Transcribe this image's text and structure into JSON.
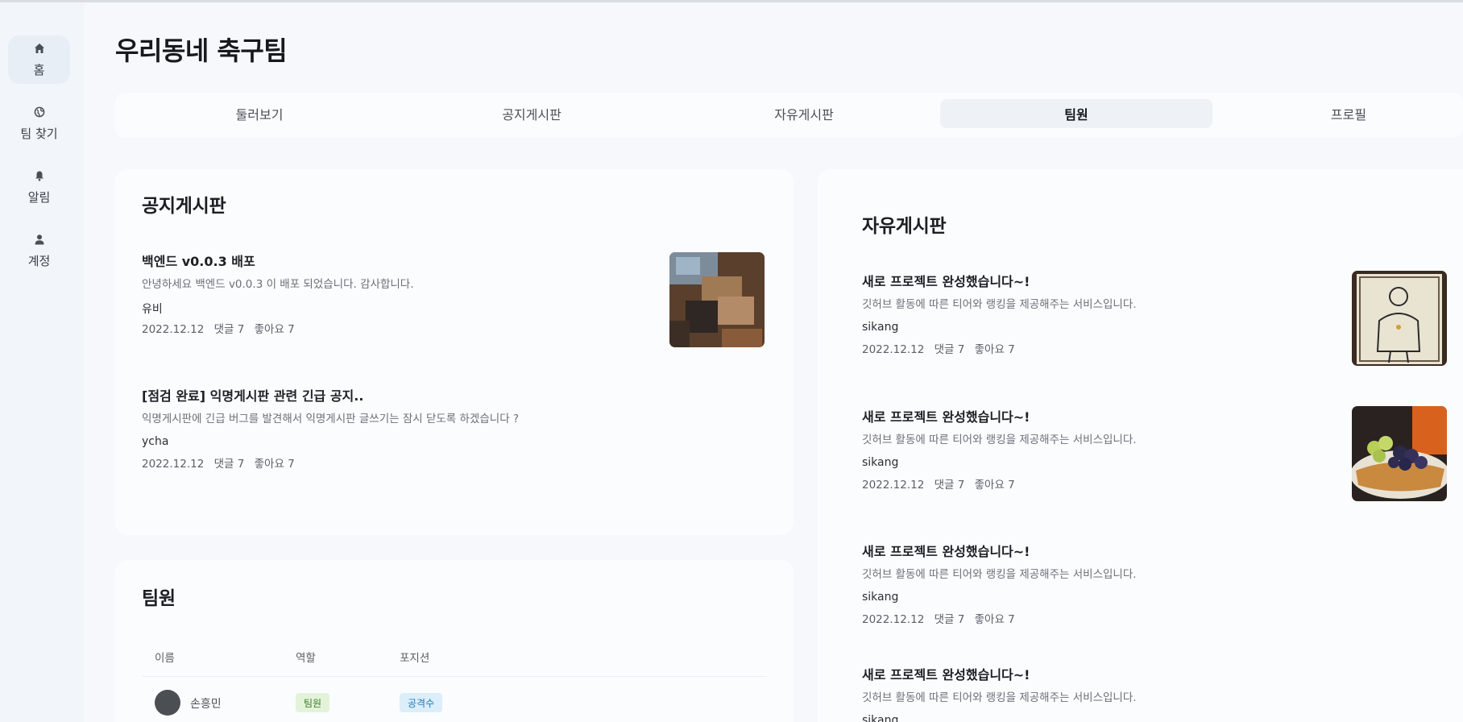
{
  "page_title": "우리동네 축구팀",
  "sidebar": {
    "items": [
      {
        "label": "홈",
        "icon": "home-icon",
        "active": true
      },
      {
        "label": "팀 찾기",
        "icon": "globe-icon",
        "active": false
      },
      {
        "label": "알림",
        "icon": "bell-icon",
        "active": false
      },
      {
        "label": "계정",
        "icon": "user-icon",
        "active": false
      }
    ]
  },
  "tabs": [
    {
      "label": "둘러보기"
    },
    {
      "label": "공지게시판"
    },
    {
      "label": "자유게시판"
    },
    {
      "label": "팀원",
      "active": true
    },
    {
      "label": "프로필"
    }
  ],
  "notice_board": {
    "title": "공지게시판",
    "posts": [
      {
        "title": "백엔드 v0.0.3 배포",
        "body": "안녕하세요 백엔드 v0.0.3 이 배포 되었습니다. 감사합니다.",
        "author": "유비",
        "date": "2022.12.12",
        "comments": "댓글 7",
        "likes": "좋아요 7"
      },
      {
        "title": "[점검 완료] 익명게시판 관련 긴급 공지..",
        "body": "익명게시판에 긴급 버그를 발견해서 익명게시판 글쓰기는 잠시 닫도록 하겠습니다 ?",
        "author": "ycha",
        "date": "2022.12.12",
        "comments": "댓글 7",
        "likes": "좋아요 7"
      }
    ]
  },
  "members": {
    "title": "팀원",
    "columns": [
      "이름",
      "역할",
      "포지션"
    ],
    "rows": [
      {
        "name": "손흥민",
        "role": "팀원",
        "position": "공격수"
      }
    ]
  },
  "free_board": {
    "title": "자유게시판",
    "posts": [
      {
        "title": "새로 프로젝트 완성했습니다~!",
        "body": "깃허브 활동에 따른 티어와 랭킹을 제공해주는 서비스입니다.",
        "author": "sikang",
        "date": "2022.12.12",
        "comments": "댓글 7",
        "likes": "좋아요 7"
      },
      {
        "title": "새로 프로젝트 완성했습니다~!",
        "body": "깃허브 활동에 따른 티어와 랭킹을 제공해주는 서비스입니다.",
        "author": "sikang",
        "date": "2022.12.12",
        "comments": "댓글 7",
        "likes": "좋아요 7"
      },
      {
        "title": "새로 프로젝트 완성했습니다~!",
        "body": "깃허브 활동에 따른 티어와 랭킹을 제공해주는 서비스입니다.",
        "author": "sikang",
        "date": "2022.12.12",
        "comments": "댓글 7",
        "likes": "좋아요 7"
      },
      {
        "title": "새로 프로젝트 완성했습니다~!",
        "body": "깃허브 활동에 따른 티어와 랭킹을 제공해주는 서비스입니다.",
        "author": "sikang"
      }
    ]
  },
  "colors": {
    "role_badge_bg": "#e3f3da",
    "role_badge_text": "#3c7a23",
    "position_badge_bg": "#dbeefa",
    "position_badge_text": "#2378b4"
  }
}
